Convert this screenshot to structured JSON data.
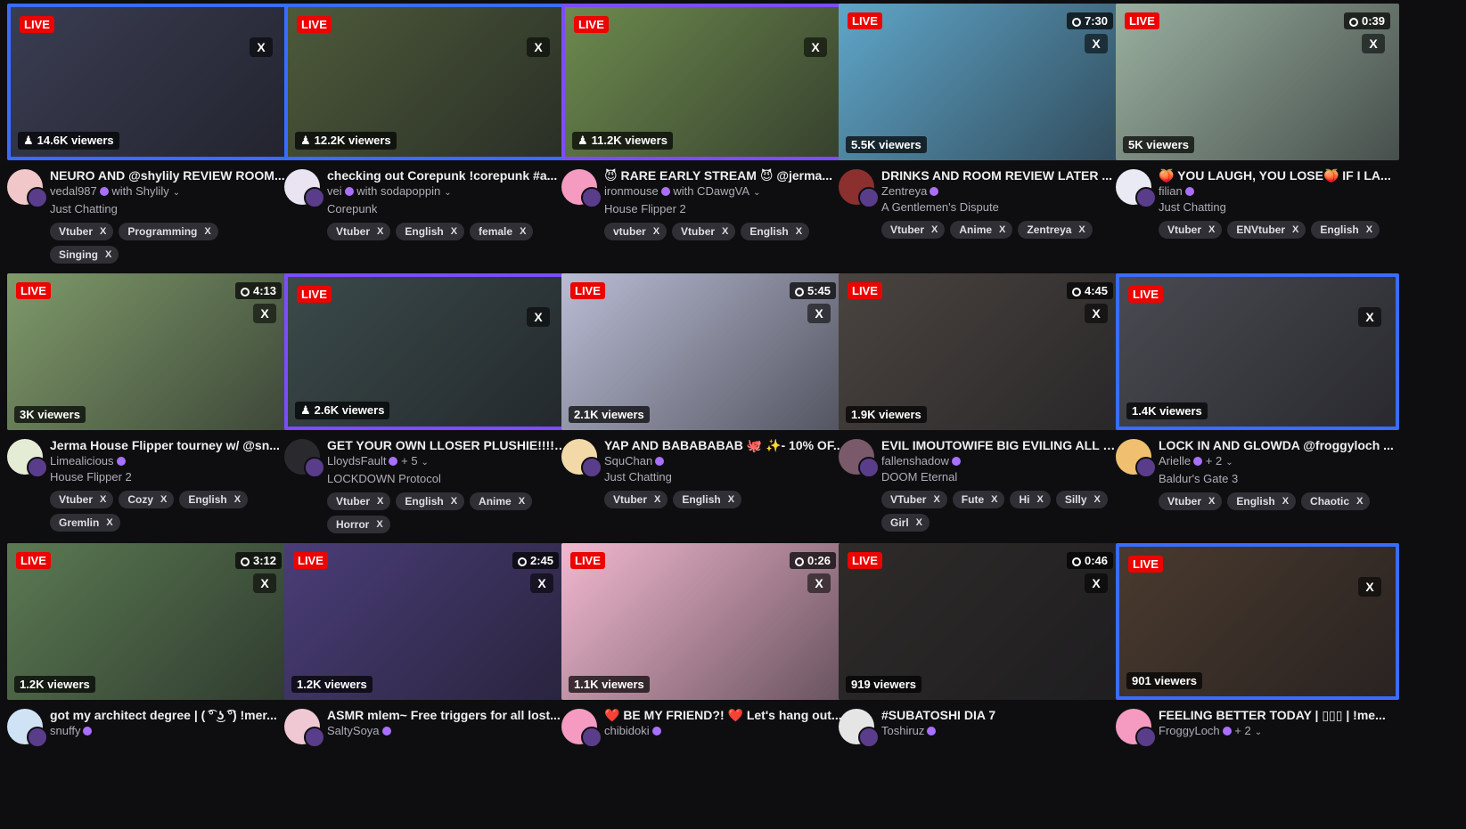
{
  "cards": [
    {
      "live": "LIVE",
      "uptime": "",
      "close": "X",
      "viewers": "14.6K viewers",
      "viewer_icon": "person-icon",
      "title": "NEURO AND @shylily REVIEW ROOM...",
      "channel": "vedal987",
      "with": "with Shylily",
      "category": "Just Chatting",
      "tags": [
        "Vtuber",
        "Programming",
        "Singing"
      ],
      "framed": true,
      "frame_color": "#3a6cff",
      "art": "#3a3d52",
      "avatar": "#f2c7c9"
    },
    {
      "live": "LIVE",
      "uptime": "",
      "close": "X",
      "viewers": "12.2K viewers",
      "viewer_icon": "person-icon",
      "title": "checking out Corepunk !corepunk #a...",
      "channel": "vei",
      "with": "with sodapoppin",
      "category": "Corepunk",
      "tags": [
        "Vtuber",
        "English",
        "female"
      ],
      "framed": true,
      "frame_color": "#3a6cff",
      "art": "#4d5a3a",
      "avatar": "#e9e3f2"
    },
    {
      "live": "LIVE",
      "uptime": "",
      "close": "X",
      "viewers": "11.2K viewers",
      "viewer_icon": "person-icon",
      "title": "😈 RARE EARLY STREAM 😈 @jerma...",
      "channel": "ironmouse",
      "with": "with CDawgVA",
      "category": "House Flipper 2",
      "tags": [
        "vtuber",
        "Vtuber",
        "English"
      ],
      "framed": true,
      "frame_color": "#7b4dff",
      "art": "#6d8a4e",
      "avatar": "#f59ac0"
    },
    {
      "live": "LIVE",
      "uptime": "7:30",
      "close": "X",
      "viewers": "5.5K viewers",
      "viewer_icon": "",
      "title": "DRINKS AND ROOM REVIEW LATER ...",
      "channel": "Zentreya",
      "with": "",
      "category": "A Gentlemen's Dispute",
      "tags": [
        "Vtuber",
        "Anime",
        "Zentreya"
      ],
      "framed": false,
      "frame_color": "",
      "art": "#5fa6c9",
      "avatar": "#8c2f2f"
    },
    {
      "live": "LIVE",
      "uptime": "0:39",
      "close": "X",
      "viewers": "5K viewers",
      "viewer_icon": "",
      "title": "🍑 YOU LAUGH, YOU LOSE🍑 IF I LA...",
      "channel": "filian",
      "with": "",
      "category": "Just Chatting",
      "tags": [
        "Vtuber",
        "ENVtuber",
        "English"
      ],
      "framed": false,
      "frame_color": "",
      "art": "#9ab0a0",
      "avatar": "#eaeaf5"
    },
    {
      "live": "LIVE",
      "uptime": "4:13",
      "close": "X",
      "viewers": "3K viewers",
      "viewer_icon": "",
      "title": "Jerma House Flipper tourney w/ @sn...",
      "channel": "Limealicious",
      "with": "",
      "category": "House Flipper 2",
      "tags": [
        "Vtuber",
        "Cozy",
        "English",
        "Gremlin"
      ],
      "framed": false,
      "frame_color": "",
      "art": "#7f9a6a",
      "avatar": "#e5ecd6"
    },
    {
      "live": "LIVE",
      "uptime": "",
      "close": "X",
      "viewers": "2.6K viewers",
      "viewer_icon": "person-icon",
      "title": "GET YOUR OWN LLOSER PLUSHIE!!!! ...",
      "channel": "LloydsFault",
      "with": "+ 5",
      "category": "LOCKDOWN Protocol",
      "tags": [
        "Vtuber",
        "English",
        "Anime",
        "Horror"
      ],
      "framed": true,
      "frame_color": "#7b4dff",
      "art": "#3b4a4a",
      "avatar": "#2a2a2e"
    },
    {
      "live": "LIVE",
      "uptime": "5:45",
      "close": "X",
      "viewers": "2.1K viewers",
      "viewer_icon": "",
      "title": "YAP AND BABABABAB 🐙 ✨- 10% OF...",
      "channel": "SquChan",
      "with": "",
      "category": "Just Chatting",
      "tags": [
        "Vtuber",
        "English"
      ],
      "framed": false,
      "frame_color": "",
      "art": "#b9bcd4",
      "avatar": "#f3d9a8"
    },
    {
      "live": "LIVE",
      "uptime": "4:45",
      "close": "X",
      "viewers": "1.9K viewers",
      "viewer_icon": "",
      "title": "EVIL IMOUTOWIFE BIG EVILING ALL O...",
      "channel": "fallenshadow",
      "with": "",
      "category": "DOOM Eternal",
      "tags": [
        "VTuber",
        "Fute",
        "Hi",
        "Silly",
        "Girl"
      ],
      "framed": false,
      "frame_color": "",
      "art": "#4a4440",
      "avatar": "#7a5a6a"
    },
    {
      "live": "LIVE",
      "uptime": "",
      "close": "X",
      "viewers": "1.4K viewers",
      "viewer_icon": "",
      "title": "LOCK IN AND GLOWDA @froggyloch ...",
      "channel": "Arielle",
      "with": "+ 2",
      "category": "Baldur's Gate 3",
      "tags": [
        "Vtuber",
        "English",
        "Chaotic"
      ],
      "framed": true,
      "frame_color": "#3a6cff",
      "art": "#4a4a52",
      "avatar": "#f0c070"
    },
    {
      "live": "LIVE",
      "uptime": "3:12",
      "close": "X",
      "viewers": "1.2K viewers",
      "viewer_icon": "",
      "title": "got my architect degree | ( ͡° ͜ʖ ͡°) !mer...",
      "channel": "snuffy",
      "with": "",
      "category": "",
      "tags": [],
      "framed": false,
      "frame_color": "",
      "art": "#5b7a52",
      "avatar": "#cfe3f5"
    },
    {
      "live": "LIVE",
      "uptime": "2:45",
      "close": "X",
      "viewers": "1.2K viewers",
      "viewer_icon": "",
      "title": "ASMR mlem~ Free triggers for all lost...",
      "channel": "SaltySoya",
      "with": "",
      "category": "",
      "tags": [],
      "framed": false,
      "frame_color": "",
      "art": "#4a3d78",
      "avatar": "#f0c8d4"
    },
    {
      "live": "LIVE",
      "uptime": "0:26",
      "close": "X",
      "viewers": "1.1K viewers",
      "viewer_icon": "",
      "title": "❤️ BE MY FRIEND?! ❤️ Let's hang out...",
      "channel": "chibidoki",
      "with": "",
      "category": "",
      "tags": [],
      "framed": false,
      "frame_color": "",
      "art": "#f2b8d0",
      "avatar": "#f59ac0"
    },
    {
      "live": "LIVE",
      "uptime": "0:46",
      "close": "X",
      "viewers": "919 viewers",
      "viewer_icon": "",
      "title": "#SUBATOSHI DIA 7",
      "channel": "Toshiruz",
      "with": "",
      "category": "",
      "tags": [],
      "framed": false,
      "frame_color": "",
      "art": "#2e2b29",
      "avatar": "#e5e5e5"
    },
    {
      "live": "LIVE",
      "uptime": "",
      "close": "X",
      "viewers": "901 viewers",
      "viewer_icon": "",
      "title": "FEELING BETTER TODAY | ▯▯▯ | !me...",
      "channel": "FroggyLoch",
      "with": "+ 2",
      "category": "",
      "tags": [],
      "framed": true,
      "frame_color": "#3a6cff",
      "art": "#4a3a2e",
      "avatar": "#f59ac0"
    }
  ]
}
